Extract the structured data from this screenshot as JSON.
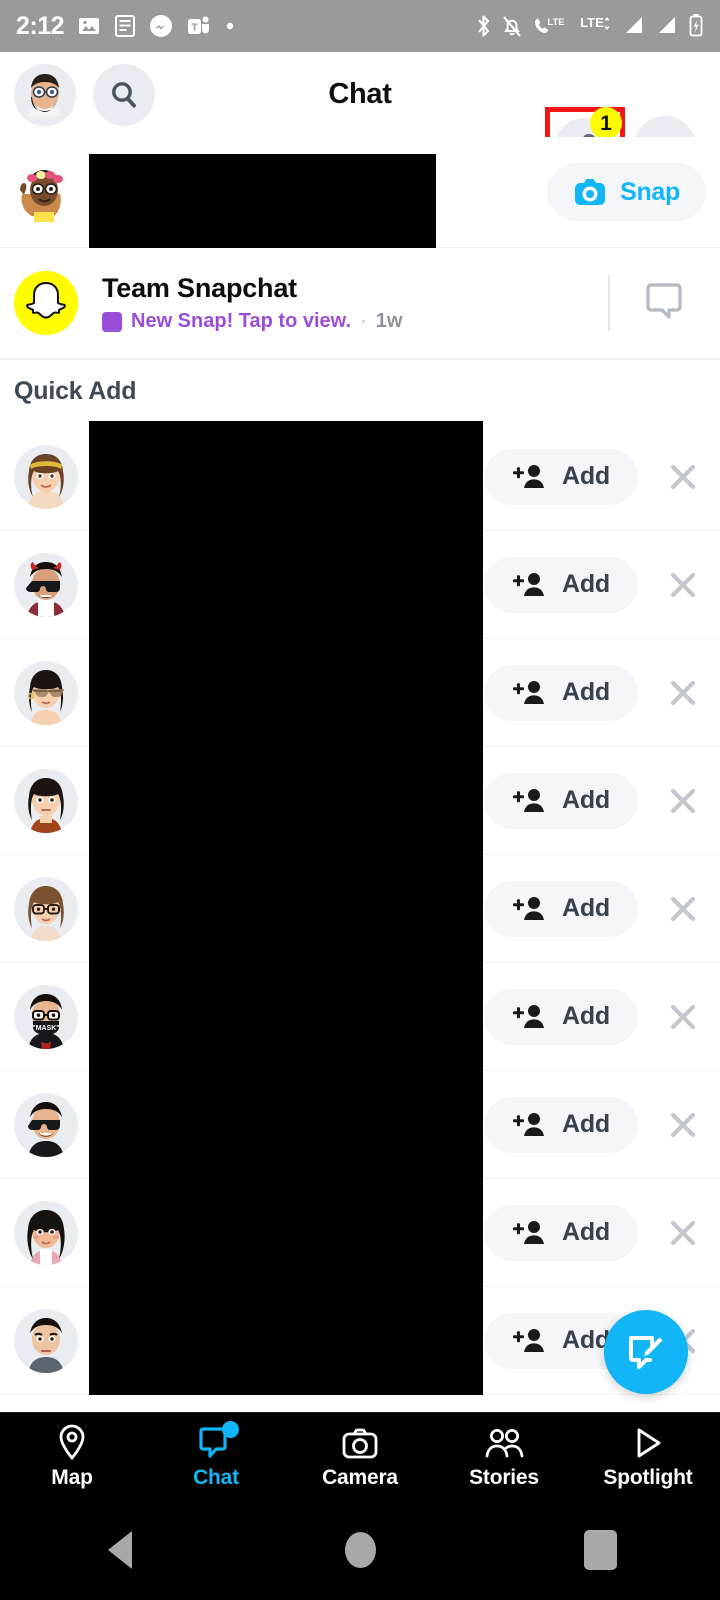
{
  "status_bar": {
    "time": "2:12",
    "left_icons": [
      "photos-icon",
      "news-icon",
      "messenger-icon",
      "teams-icon",
      "dot-icon"
    ],
    "right_icons": [
      "bluetooth-icon",
      "mute-bell-icon",
      "volte-icon",
      "lte-data-icon",
      "signal-bar-1-icon",
      "signal-bar-2-icon",
      "battery-charging-icon"
    ],
    "background_color": "#9a9a9a"
  },
  "header": {
    "title": "Chat",
    "profile_avatar": "bitmoji-avatar",
    "search_icon": "search-icon",
    "add_friend_icon": "add-friend-icon",
    "add_friend_badge": "1",
    "more_icon": "more-options-icon",
    "highlight_color": "#f41414",
    "badge_color": "#fffc00"
  },
  "chat_list": [
    {
      "avatar": "bitmoji-avatar-flower-crown",
      "name_redacted": true,
      "name": "",
      "action_label": "Snap",
      "action_icon": "camera-icon",
      "action_color": "#12b5f5"
    },
    {
      "avatar": "snapchat-ghost-icon",
      "name_redacted": false,
      "name": "Team Snapchat",
      "status_text": "New Snap! Tap to view.",
      "status_color": "#9a4dd6",
      "status_separator": "·",
      "timestamp": "1w",
      "trailing_icon": "chat-bubble-icon"
    }
  ],
  "quick_add": {
    "section_title": "Quick Add",
    "add_label": "Add",
    "add_icon": "add-person-icon",
    "dismiss_icon": "close-icon",
    "rows": [
      {
        "avatar": "bitmoji-woman-headband",
        "name_redacted": true,
        "name": ""
      },
      {
        "avatar": "bitmoji-man-horns-sunglasses",
        "name_redacted": true,
        "name": ""
      },
      {
        "avatar": "bitmoji-woman-aviators",
        "name_redacted": true,
        "name": ""
      },
      {
        "avatar": "bitmoji-woman-brown-top",
        "name_redacted": true,
        "name": ""
      },
      {
        "avatar": "bitmoji-woman-glasses",
        "name_redacted": true,
        "name": ""
      },
      {
        "avatar": "bitmoji-man-mask",
        "name_redacted": true,
        "name": ""
      },
      {
        "avatar": "bitmoji-man-sunglasses",
        "name_redacted": true,
        "name": ""
      },
      {
        "avatar": "bitmoji-woman-long-hair",
        "name_redacted": true,
        "name": ""
      },
      {
        "avatar": "bitmoji-man-grey-shirt",
        "name_redacted": true,
        "name": ""
      }
    ]
  },
  "fab": {
    "icon": "new-chat-icon",
    "color": "#12b5f5"
  },
  "bottom_nav": {
    "items": [
      {
        "label": "Map",
        "icon": "map-pin-icon",
        "active": false,
        "badge": false
      },
      {
        "label": "Chat",
        "icon": "chat-bubble-icon",
        "active": true,
        "badge": true
      },
      {
        "label": "Camera",
        "icon": "camera-icon",
        "active": false,
        "badge": false
      },
      {
        "label": "Stories",
        "icon": "people-icon",
        "active": false,
        "badge": false
      },
      {
        "label": "Spotlight",
        "icon": "play-triangle-icon",
        "active": false,
        "badge": false
      }
    ],
    "active_color": "#12b5f5"
  },
  "android_nav": {
    "back_icon": "back-triangle-icon",
    "home_icon": "home-circle-icon",
    "recents_icon": "recents-square-icon"
  }
}
